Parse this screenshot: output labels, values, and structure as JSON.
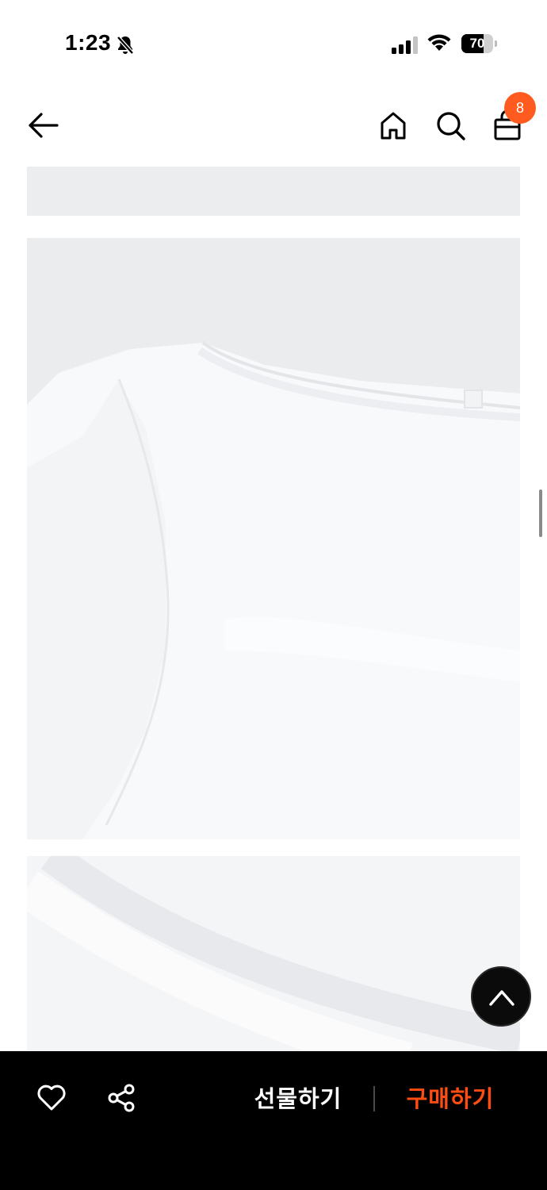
{
  "status_bar": {
    "time": "1:23",
    "battery_level": 70,
    "battery_text": "70",
    "icons": [
      "bell-slash-icon",
      "cellular-signal-icon",
      "wifi-icon",
      "battery-icon"
    ]
  },
  "header": {
    "icons": [
      "arrow-left-icon",
      "home-icon",
      "search-icon",
      "shopping-bag-icon"
    ],
    "cart_count": "8"
  },
  "product_images": [
    {
      "name": "product-image-partial-top",
      "color": "#ebedef"
    },
    {
      "name": "product-image-shirt-neckline",
      "color": "#eaecee"
    },
    {
      "name": "product-image-fabric-detail",
      "color": "#eceef0"
    }
  ],
  "bottom_bar": {
    "like_icon": "heart-icon",
    "share_icon": "share-icon",
    "gift_label": "선물하기",
    "buy_label": "구매하기"
  },
  "colors": {
    "accent": "#ff5a1f",
    "buy_text": "#ff4d12",
    "bottom_bar_bg": "#000000",
    "image_bg": "#eaecee"
  }
}
